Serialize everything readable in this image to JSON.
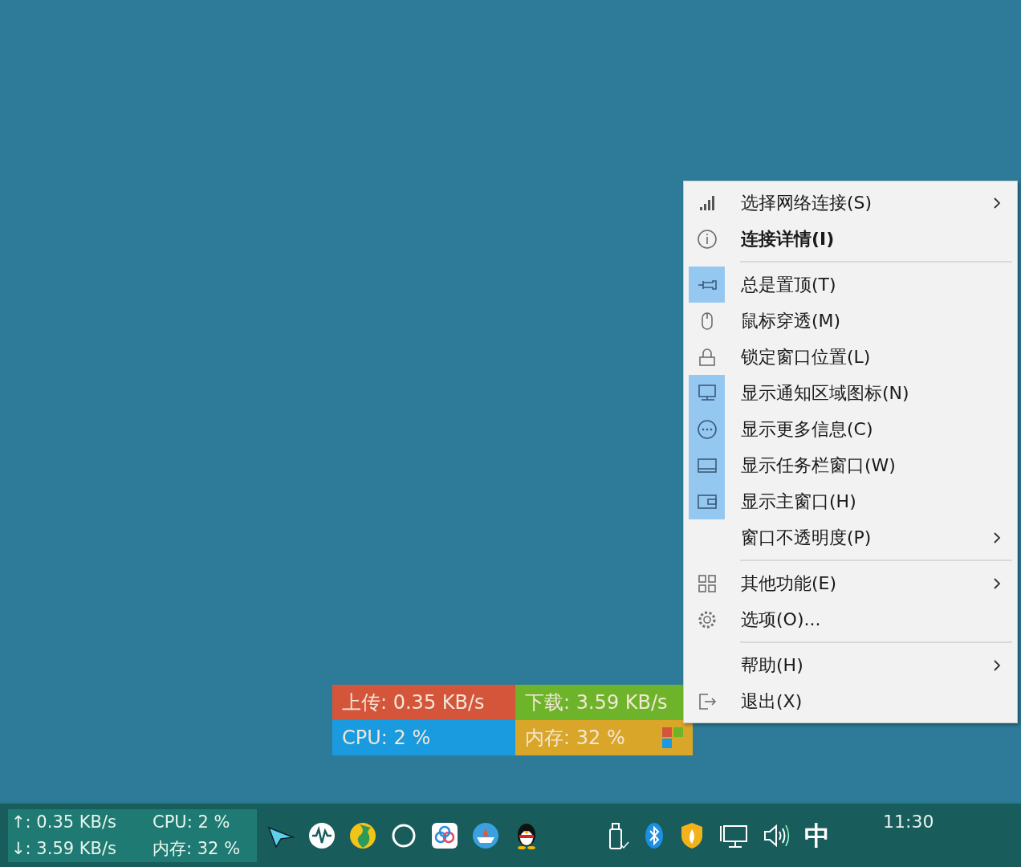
{
  "widget": {
    "cells": [
      {
        "kind": "upload",
        "text": "上传: 0.35 KB/s",
        "color": "#d5553b"
      },
      {
        "kind": "download",
        "text": "下载: 3.59 KB/s",
        "color": "#6eb42a"
      },
      {
        "kind": "cpu",
        "text": "CPU: 2 %",
        "color": "#1a9be0"
      },
      {
        "kind": "memory",
        "text": "内存: 32 %",
        "color": "#d9a62a"
      }
    ]
  },
  "menu": {
    "items": [
      {
        "kind": "item",
        "label": "选择网络连接(S)",
        "checked": false,
        "submenu": true,
        "bold": false
      },
      {
        "kind": "item",
        "label": "连接详情(I)",
        "checked": false,
        "submenu": false,
        "bold": true
      },
      {
        "kind": "separator"
      },
      {
        "kind": "item",
        "label": "总是置顶(T)",
        "checked": true,
        "submenu": false,
        "bold": false
      },
      {
        "kind": "item",
        "label": "鼠标穿透(M)",
        "checked": false,
        "submenu": false,
        "bold": false
      },
      {
        "kind": "item",
        "label": "锁定窗口位置(L)",
        "checked": false,
        "submenu": false,
        "bold": false
      },
      {
        "kind": "item",
        "label": "显示通知区域图标(N)",
        "checked": true,
        "submenu": false,
        "bold": false
      },
      {
        "kind": "item",
        "label": "显示更多信息(C)",
        "checked": true,
        "submenu": false,
        "bold": false
      },
      {
        "kind": "item",
        "label": "显示任务栏窗口(W)",
        "checked": true,
        "submenu": false,
        "bold": false
      },
      {
        "kind": "item",
        "label": "显示主窗口(H)",
        "checked": true,
        "submenu": false,
        "bold": false
      },
      {
        "kind": "item",
        "label": "窗口不透明度(P)",
        "checked": false,
        "submenu": true,
        "bold": false
      },
      {
        "kind": "separator"
      },
      {
        "kind": "item",
        "label": "其他功能(E)",
        "checked": false,
        "submenu": true,
        "bold": false
      },
      {
        "kind": "item",
        "label": "选项(O)...",
        "checked": false,
        "submenu": false,
        "bold": false
      },
      {
        "kind": "separator"
      },
      {
        "kind": "item",
        "label": "帮助(H)",
        "checked": false,
        "submenu": true,
        "bold": false
      },
      {
        "kind": "item",
        "label": "退出(X)",
        "checked": false,
        "submenu": false,
        "bold": false
      }
    ]
  },
  "taskbar": {
    "speed": [
      "↑: 0.35 KB/s",
      "↓: 3.59 KB/s"
    ],
    "usage": [
      "CPU: 2 %",
      "内存: 32 %"
    ],
    "ime": "中",
    "clock": "11:30"
  }
}
